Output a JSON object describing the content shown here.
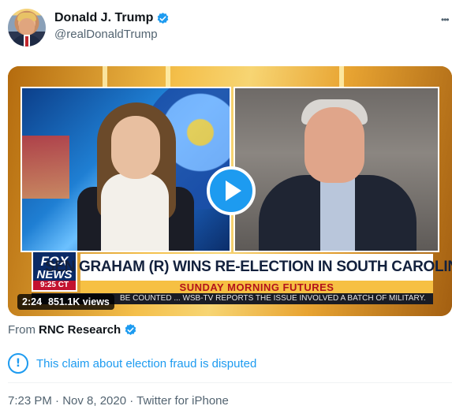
{
  "author": {
    "name": "Donald J. Trump",
    "handle": "@realDonaldTrump",
    "verified": true
  },
  "video": {
    "headline": "SEN GRAHAM (R) WINS RE-ELECTION IN SOUTH CAROLINA",
    "show_name": "SUNDAY MORNING FUTURES",
    "network_line1": "FOX",
    "network_line2": "NEWS",
    "clock": "9:25 CT",
    "ticker": "BE COUNTED ... WSB-TV REPORTS THE ISSUE INVOLVED A BATCH OF MILITARY.",
    "duration": "2:24",
    "views": "851.1K views"
  },
  "source": {
    "prefix": "From",
    "name": "RNC Research",
    "verified": true
  },
  "notice": {
    "icon": "info-icon",
    "text": "This claim about election fraud is disputed"
  },
  "meta": {
    "text": "7:23 PM · Nov 8, 2020 · Twitter for iPhone"
  },
  "colors": {
    "accent": "#1d9bf0",
    "text": "#0f1419",
    "muted": "#536471"
  }
}
